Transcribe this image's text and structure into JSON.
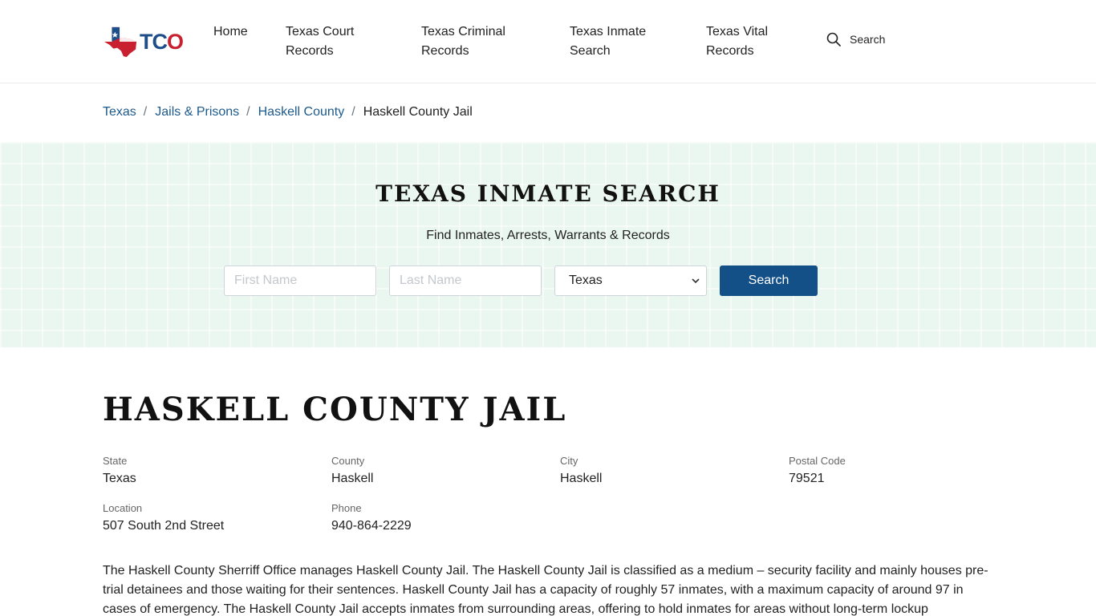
{
  "header": {
    "logo_text_primary": "TC",
    "logo_text_accent": "O",
    "nav": [
      {
        "label": "Home"
      },
      {
        "label": "Texas Court Records"
      },
      {
        "label": "Texas Criminal Records"
      },
      {
        "label": "Texas Inmate Search"
      },
      {
        "label": "Texas Vital Records"
      }
    ],
    "search_label": "Search"
  },
  "breadcrumb": {
    "items": [
      "Texas",
      "Jails & Prisons",
      "Haskell County"
    ],
    "current": "Haskell County Jail",
    "separator": "/"
  },
  "hero": {
    "title": "TEXAS INMATE SEARCH",
    "subtitle": "Find Inmates, Arrests, Warrants & Records",
    "first_name_placeholder": "First Name",
    "last_name_placeholder": "Last Name",
    "state_selected": "Texas",
    "search_button": "Search"
  },
  "main": {
    "title": "HASKELL COUNTY JAIL",
    "info": {
      "state": {
        "label": "State",
        "value": "Texas"
      },
      "county": {
        "label": "County",
        "value": "Haskell"
      },
      "city": {
        "label": "City",
        "value": "Haskell"
      },
      "postal": {
        "label": "Postal Code",
        "value": "79521"
      },
      "location": {
        "label": "Location",
        "value": "507 South 2nd Street"
      },
      "phone": {
        "label": "Phone",
        "value": "940-864-2229"
      }
    },
    "description": "The Haskell County Sherriff Office manages Haskell County Jail. The Haskell County Jail is classified as a medium – security facility and mainly houses pre-trial detainees and those waiting for their sentences. Haskell County Jail has a capacity of roughly 57 inmates, with a maximum capacity of around 97 in cases of emergency. The Haskell County Jail accepts inmates from surrounding areas, offering to hold inmates for areas without long-term lockup"
  },
  "colors": {
    "brand_blue": "#1d4e89",
    "brand_red": "#c8202f",
    "button_blue": "#135087",
    "link_blue": "#1d5a8c",
    "hero_bg": "#eaf7f0"
  }
}
